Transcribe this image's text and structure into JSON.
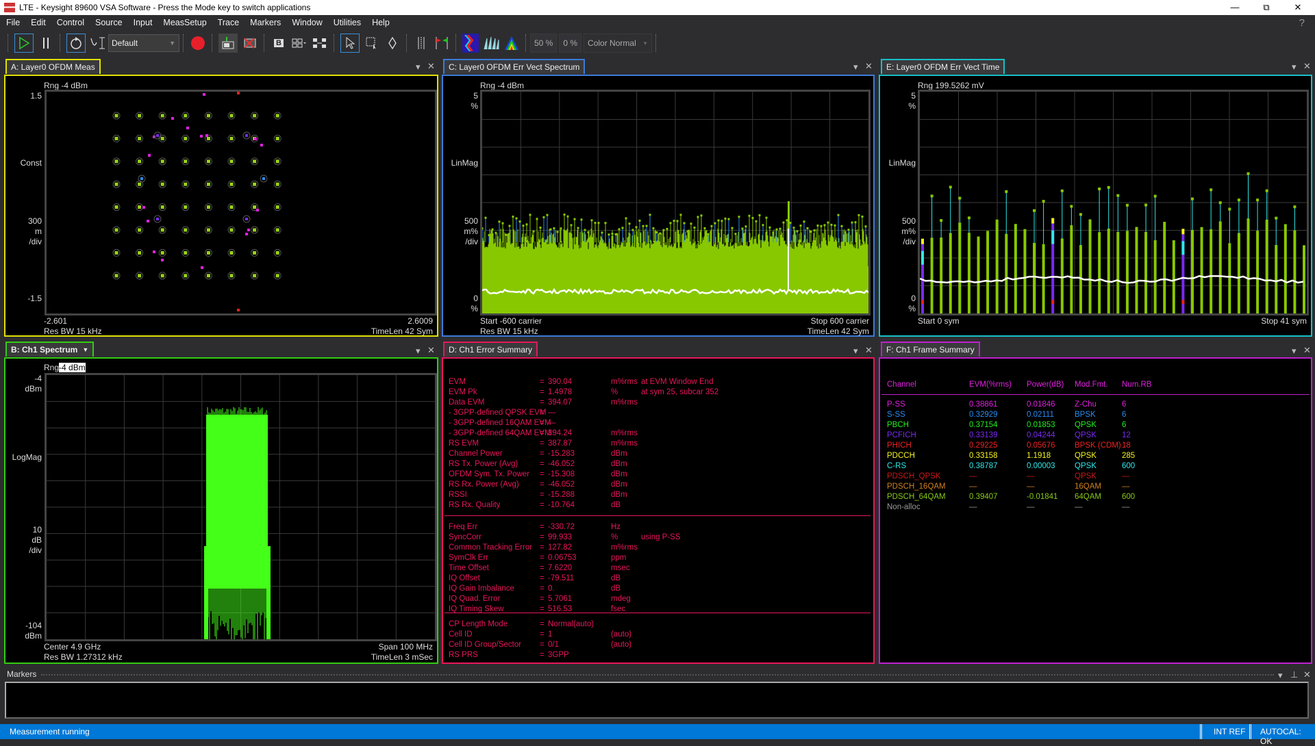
{
  "window": {
    "title": "LTE - Keysight 89600 VSA Software - Press the Mode key to switch applications"
  },
  "menu": [
    "File",
    "Edit",
    "Control",
    "Source",
    "Input",
    "MeasSetup",
    "Trace",
    "Markers",
    "Window",
    "Utilities",
    "Help"
  ],
  "help_label": "?",
  "toolbar": {
    "preset_value": "Default",
    "percent_1": "50 %",
    "percent_2": "0 %",
    "color_mode": "Color Normal",
    "b_label": "B"
  },
  "colors": {
    "panel_a": "#e0e000",
    "panel_b": "#33cc11",
    "panel_c": "#3c7bd9",
    "panel_d": "#e8175a",
    "panel_e": "#17c0c8",
    "panel_f": "#c020d0",
    "status_bar": "#0078d7"
  },
  "panels": {
    "a": {
      "title": "A: Layer0 OFDM Meas",
      "range": "Rng -4 dBm",
      "y_top": "1.5",
      "y_mid_label": "Const",
      "scale_val": "300",
      "scale_unit1": "m",
      "scale_unit2": "/div",
      "y_bot": "-1.5",
      "x_left": "-2.601",
      "x_right": "2.6009",
      "foot_left": "Res BW 15 kHz",
      "foot_right": "TimeLen 42  Sym"
    },
    "b": {
      "title": "B: Ch1 Spectrum",
      "range_prefix": "Rng",
      "range_value": "-4 dBm",
      "y_top": "-4",
      "y_top_unit": "dBm",
      "y_mid_label": "LogMag",
      "scale_val": "10",
      "scale_unit1": "dB",
      "scale_unit2": "/div",
      "y_bot": "-104",
      "y_bot_unit": "dBm",
      "center": "Center 4.9 GHz",
      "span": "Span 100 MHz",
      "res_bw": "Res BW 1.27312 kHz",
      "timelen": "TimeLen 3 mSec"
    },
    "c": {
      "title": "C: Layer0 OFDM Err Vect Spectrum",
      "range": "Rng -4 dBm",
      "y_top": "5",
      "y_top_unit": "%",
      "y_mid_label": "LinMag",
      "scale_val": "500",
      "scale_unit1": "m%",
      "scale_unit2": "/div",
      "y_bot": "0",
      "y_bot_unit": "%",
      "start": "Start -600  carrier",
      "stop": "Stop 600  carrier",
      "res_bw": "Res BW 15 kHz",
      "timelen": "TimeLen 42  Sym"
    },
    "d": {
      "title": "D: Ch1 Error Summary"
    },
    "e": {
      "title": "E: Layer0 OFDM Err Vect Time",
      "range": "Rng 199.5262 mV",
      "y_top": "5",
      "y_top_unit": "%",
      "y_mid_label": "LinMag",
      "scale_val": "500",
      "scale_unit1": "m%",
      "scale_unit2": "/div",
      "y_bot": "0",
      "y_bot_unit": "%",
      "start": "Start 0  sym",
      "stop": "Stop 41  sym"
    },
    "f": {
      "title": "F: Ch1 Frame Summary"
    }
  },
  "error_summary": {
    "section1": [
      {
        "label": "EVM",
        "value": "390.04",
        "unit": "m%rms",
        "extra": "at   EVM Window End"
      },
      {
        "label": "EVM Pk",
        "value": "1.4978",
        "unit": "%",
        "extra": "at   sym  25,   subcar   352"
      },
      {
        "label": "Data EVM",
        "value": "394.07",
        "unit": "m%rms",
        "extra": ""
      },
      {
        "label": " - 3GPP-defined QPSK EVM",
        "value": "—",
        "unit": "",
        "extra": ""
      },
      {
        "label": " - 3GPP-defined 16QAM EVM",
        "value": "—",
        "unit": "",
        "extra": ""
      },
      {
        "label": " - 3GPP-defined 64QAM EVM",
        "value": "394.24",
        "unit": "m%rms",
        "extra": ""
      },
      {
        "label": "RS EVM",
        "value": "387.87",
        "unit": "m%rms",
        "extra": ""
      },
      {
        "label": "Channel Power",
        "value": "-15.283",
        "unit": "dBm",
        "extra": ""
      },
      {
        "label": "RS Tx. Power (Avg)",
        "value": "-46.052",
        "unit": "dBm",
        "extra": ""
      },
      {
        "label": "OFDM Sym. Tx. Power",
        "value": "-15.308",
        "unit": "dBm",
        "extra": ""
      },
      {
        "label": "RS Rx. Power (Avg)",
        "value": "-46.052",
        "unit": "dBm",
        "extra": ""
      },
      {
        "label": "RSSI",
        "value": "-15.288",
        "unit": "dBm",
        "extra": ""
      },
      {
        "label": "RS Rx. Quality",
        "value": "-10.764",
        "unit": "dB",
        "extra": ""
      }
    ],
    "section2": [
      {
        "label": "Freq Err",
        "value": "-330.72",
        "unit": "Hz",
        "extra": ""
      },
      {
        "label": "SyncCorr",
        "value": "99.933",
        "unit": "%",
        "extra": "using    P-SS"
      },
      {
        "label": "Common Tracking Error",
        "value": "127.82",
        "unit": "m%rms",
        "extra": ""
      },
      {
        "label": "SymClk Err",
        "value": "0.06753",
        "unit": "ppm",
        "extra": ""
      },
      {
        "label": "Time Offset",
        "value": "7.6220",
        "unit": "msec",
        "extra": ""
      },
      {
        "label": "IQ Offset",
        "value": "-79.511",
        "unit": "dB",
        "extra": ""
      },
      {
        "label": "IQ Gain Imbalance",
        "value": "0.",
        "unit": "dB",
        "extra": ""
      },
      {
        "label": "IQ Quad. Error",
        "value": "5.7061",
        "unit": "mdeg",
        "extra": ""
      },
      {
        "label": "IQ Timing Skew",
        "value": "516.53",
        "unit": "fsec",
        "extra": ""
      }
    ],
    "section3": [
      {
        "label": "CP Length Mode",
        "value": "Normal(auto)",
        "unit": "",
        "extra": ""
      },
      {
        "label": "Cell ID",
        "value": "1",
        "unit": "(auto)",
        "extra": ""
      },
      {
        "label": "Cell ID Group/Sector",
        "value": "0/1",
        "unit": "(auto)",
        "extra": ""
      },
      {
        "label": "RS PRS",
        "value": "3GPP",
        "unit": "",
        "extra": ""
      }
    ]
  },
  "frame_summary": {
    "headers": [
      "Channel",
      "EVM(%rms)",
      "Power(dB)",
      "Mod.Fmt.",
      "Num.RB"
    ],
    "rows": [
      {
        "cells": [
          "P-SS",
          "0.38861",
          "0.01846",
          "Z-Chu",
          "6"
        ],
        "color": "#e020e0"
      },
      {
        "cells": [
          "S-SS",
          "0.32929",
          "0.02111",
          "BPSK",
          "6"
        ],
        "color": "#2a8cf0"
      },
      {
        "cells": [
          "PBCH",
          "0.37154",
          "0.01853",
          "QPSK",
          "6"
        ],
        "color": "#22ee22"
      },
      {
        "cells": [
          "PCFICH",
          "0.33139",
          "0.04244",
          "QPSK",
          "12"
        ],
        "color": "#7a2af0"
      },
      {
        "cells": [
          "PHICH",
          "0.29225",
          "0.05676",
          "BPSK (CDM)",
          "18"
        ],
        "color": "#ee2222"
      },
      {
        "cells": [
          "PDCCH",
          "0.33158",
          "1.1918",
          "QPSK",
          "285"
        ],
        "color": "#f5f520"
      },
      {
        "cells": [
          "C-RS",
          "0.38787",
          "0.00003",
          "QPSK",
          "600"
        ],
        "color": "#30e8e8"
      },
      {
        "cells": [
          "PDSCH_QPSK",
          "—",
          "—",
          "QPSK",
          "—"
        ],
        "color": "#c81818"
      },
      {
        "cells": [
          "PDSCH_16QAM",
          "—",
          "—",
          "16QAM",
          "—"
        ],
        "color": "#d08020"
      },
      {
        "cells": [
          "PDSCH_64QAM",
          "0.39407",
          "-0.01841",
          "64QAM",
          "600"
        ],
        "color": "#88c818"
      },
      {
        "cells": [
          "Non-alloc",
          "—",
          "—",
          "—",
          "—"
        ],
        "color": "#999999"
      }
    ]
  },
  "markers_panel": {
    "title": "Markers"
  },
  "status": {
    "text": "Measurement running",
    "int_ref": "INT REF",
    "autocal": "AUTOCAL: OK"
  }
}
